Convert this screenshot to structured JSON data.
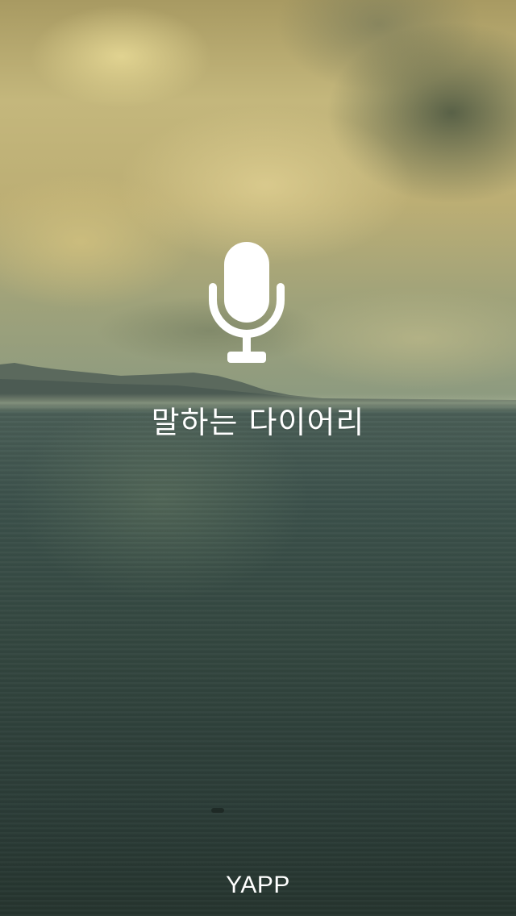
{
  "splash": {
    "title": "말하는 다이어리",
    "brand": "YAPP",
    "icon": "microphone-icon"
  },
  "colors": {
    "text": "#ffffff",
    "sky": "#c4b77c",
    "sea": "#33463f"
  }
}
